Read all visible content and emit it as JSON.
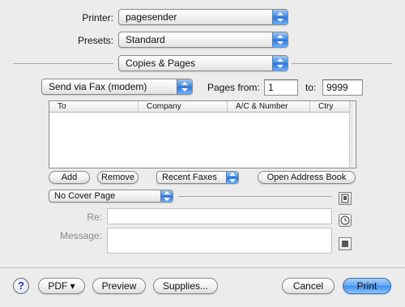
{
  "printer": {
    "label": "Printer:",
    "value": "pagesender"
  },
  "presets": {
    "label": "Presets:",
    "value": "Standard"
  },
  "panel": {
    "value": "Copies & Pages"
  },
  "send_mode": {
    "value": "Send via Fax (modem)"
  },
  "pages": {
    "from_label": "Pages from:",
    "from_value": "1",
    "to_label": "to:",
    "to_value": "9999"
  },
  "table": {
    "columns": [
      "To",
      "Company",
      "A/C & Number",
      "Ctry"
    ],
    "rows": []
  },
  "actions": {
    "add": "Add",
    "remove": "Remove",
    "recent": "Recent Faxes",
    "address_book": "Open Address Book"
  },
  "cover": {
    "value": "No Cover Page"
  },
  "re": {
    "label": "Re:",
    "value": ""
  },
  "message": {
    "label": "Message:",
    "value": ""
  },
  "footer": {
    "help": "?",
    "pdf": "PDF ▾",
    "preview": "Preview",
    "supplies": "Supplies...",
    "cancel": "Cancel",
    "print": "Print"
  }
}
